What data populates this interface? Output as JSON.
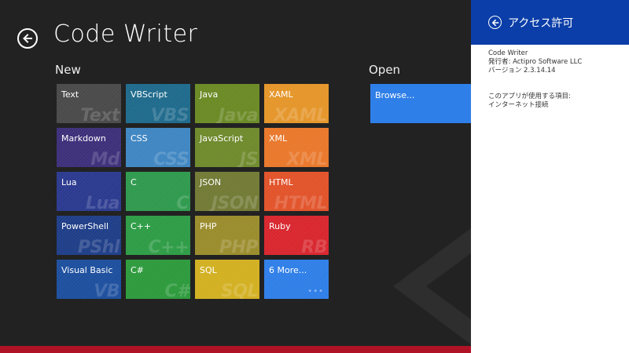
{
  "app": {
    "title": "Code Writer"
  },
  "sections": {
    "new_label": "New",
    "open_label": "Open"
  },
  "tiles": [
    {
      "label": "Text",
      "watermark": "Text",
      "color": "#4a4a4a"
    },
    {
      "label": "VBScript",
      "watermark": "VBS",
      "color": "#1f6a8c"
    },
    {
      "label": "Java",
      "watermark": "Java",
      "color": "#6b8a25"
    },
    {
      "label": "XAML",
      "watermark": "XAML",
      "color": "#e5962a"
    },
    {
      "label": "Markdown",
      "watermark": "Md",
      "color": "#3e2f7a"
    },
    {
      "label": "CSS",
      "watermark": "CSS",
      "color": "#3f86c2"
    },
    {
      "label": "JavaScript",
      "watermark": "JS",
      "color": "#6f8a2c"
    },
    {
      "label": "XML",
      "watermark": "XML",
      "color": "#e9782b"
    },
    {
      "label": "Lua",
      "watermark": "Lua",
      "color": "#2b3a8f"
    },
    {
      "label": "C",
      "watermark": "C",
      "color": "#2f9a4e"
    },
    {
      "label": "JSON",
      "watermark": "JSON",
      "color": "#727a35"
    },
    {
      "label": "HTML",
      "watermark": "HTML",
      "color": "#e2532a"
    },
    {
      "label": "PowerShell",
      "watermark": "PShl",
      "color": "#1f3e88"
    },
    {
      "label": "C++",
      "watermark": "C++",
      "color": "#2e9c46"
    },
    {
      "label": "PHP",
      "watermark": "PHP",
      "color": "#9a8c2c"
    },
    {
      "label": "Ruby",
      "watermark": "RB",
      "color": "#d9262e"
    },
    {
      "label": "Visual Basic",
      "watermark": "VB",
      "color": "#1d4f9e"
    },
    {
      "label": "C#",
      "watermark": "C#",
      "color": "#2d9a3c"
    },
    {
      "label": "SQL",
      "watermark": "SQL",
      "color": "#d2b021"
    },
    {
      "label": "6 More...",
      "watermark": "•••",
      "color": "#2f7fe8"
    }
  ],
  "open": {
    "browse_label": "Browse..."
  },
  "panel": {
    "title": "アクセス許可",
    "app_name": "Code Writer",
    "publisher": "発行者: Actipro Software LLC",
    "version": "バージョン 2.3.14.14",
    "permissions_heading": "このアプリが使用する項目:",
    "permissions": [
      "インターネット接続"
    ]
  },
  "colors": {
    "background": "#222222",
    "panel_header": "#0b3ea8",
    "bottom_bar": "#b01226"
  },
  "icons": {
    "back": "back-arrow-icon",
    "decoration": "chevron-left-icon"
  }
}
